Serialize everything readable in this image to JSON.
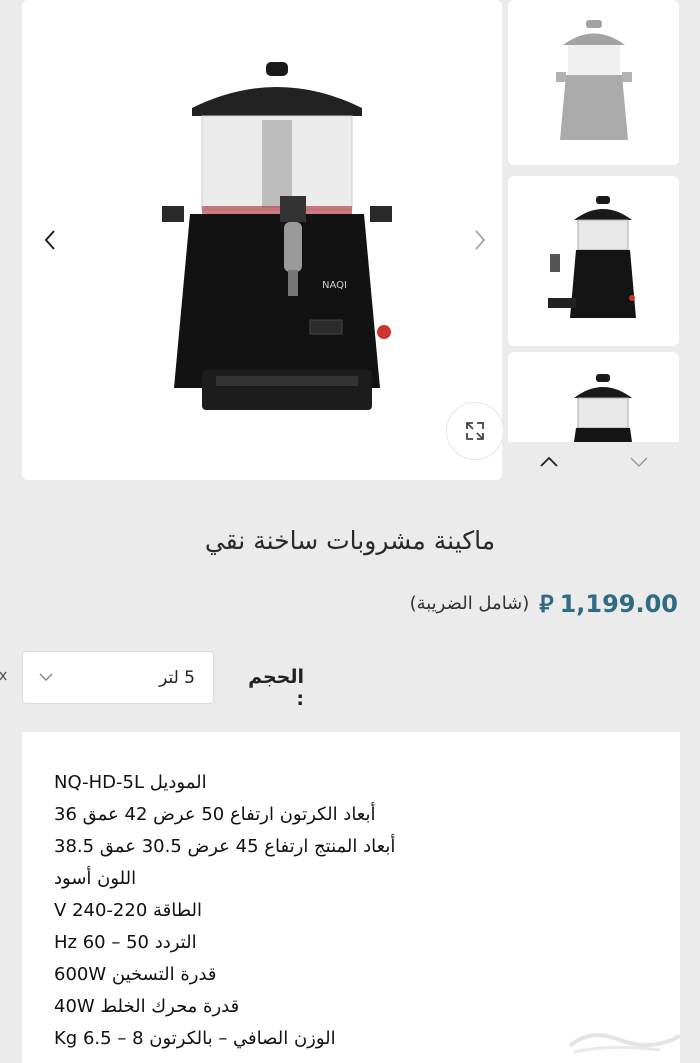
{
  "product": {
    "title": "ماكينة مشروبات ساخنة نقي",
    "price": "1,199.00",
    "currency_symbol": "⃁",
    "tax_note": "(شامل الضريبة)",
    "brand_mark": "NAQI"
  },
  "options": {
    "size_label": "الحجم :",
    "size_value": "5 لتر"
  },
  "specs": [
    "NQ-HD-5L الموديل",
    "أبعاد الكرتون ارتفاع 50 عرض 42 عمق 36",
    "أبعاد المنتج ارتفاع 45 عرض 30.5 عمق 38.5",
    "اللون أسود",
    "الطاقة 220-240 V",
    "التردد 50 – 60 Hz",
    "قدرة التسخين 600W",
    "قدرة محرك الخلط  40W",
    "الوزن الصافي – بالكرتون 8 – 6.5 Kg"
  ],
  "icons": {
    "prev": "chevron-left-icon",
    "next": "chevron-right-icon",
    "zoom": "expand-icon",
    "thumb_up": "chevron-up-icon",
    "thumb_down": "chevron-down-icon"
  },
  "colors": {
    "price": "#2f6b82",
    "background": "#ebebeb",
    "card": "#ffffff"
  }
}
